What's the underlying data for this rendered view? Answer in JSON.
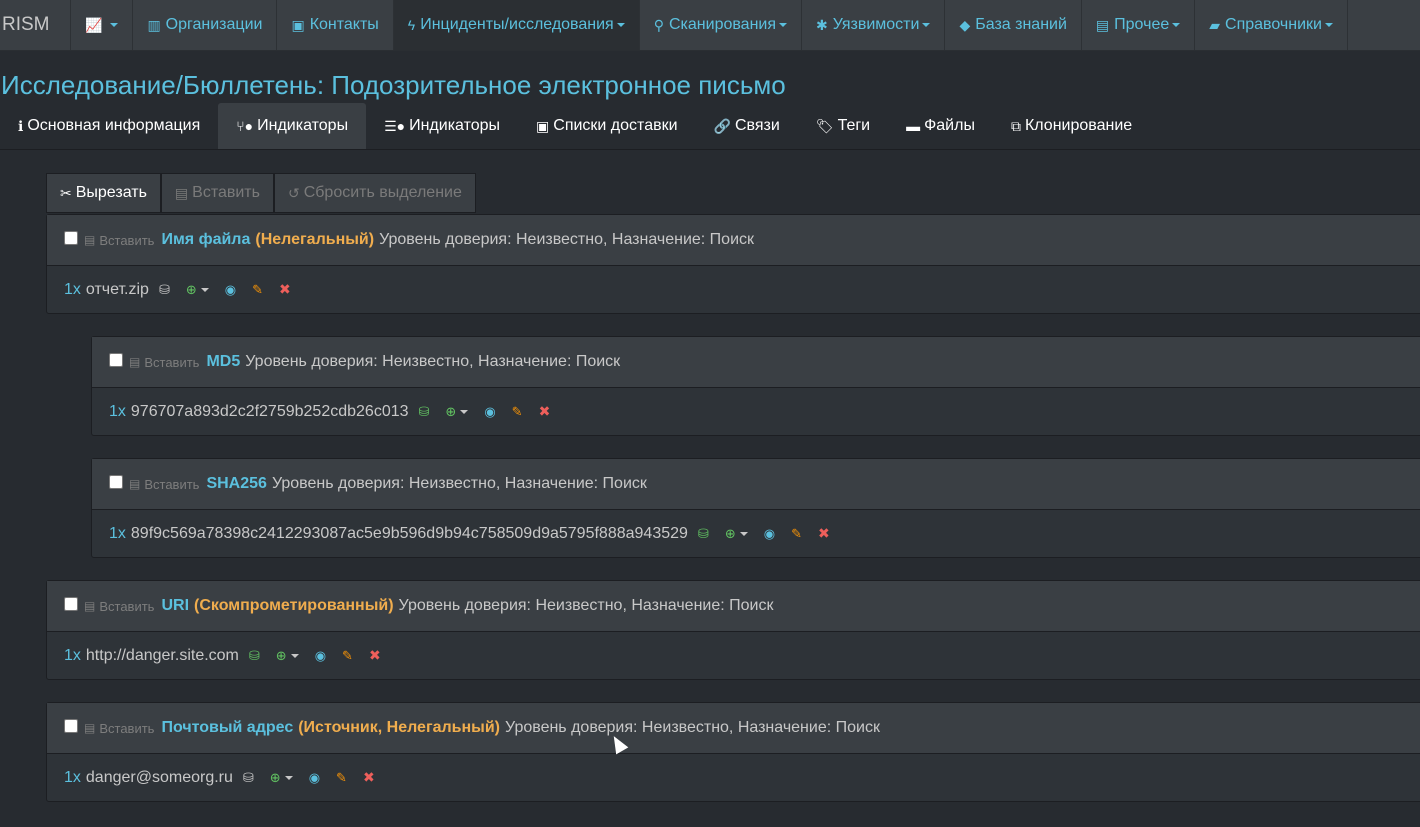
{
  "nav": {
    "brand": "RISM",
    "items": [
      {
        "label": "",
        "icon": "chart-icon",
        "caret": true
      },
      {
        "label": "Организации",
        "icon": "bar-chart-icon",
        "caret": false
      },
      {
        "label": "Контакты",
        "icon": "contact-card-icon",
        "caret": false
      },
      {
        "label": "Инциденты/исследования",
        "icon": "bolt-icon",
        "caret": true
      },
      {
        "label": "Сканирования",
        "icon": "search-icon",
        "caret": true
      },
      {
        "label": "Уязвимости",
        "icon": "bug-icon",
        "caret": true
      },
      {
        "label": "База знаний",
        "icon": "graduation-cap-icon",
        "caret": false
      },
      {
        "label": "Прочее",
        "icon": "archive-icon",
        "caret": true
      },
      {
        "label": "Справочники",
        "icon": "book-icon",
        "caret": true
      }
    ]
  },
  "page_title": "Исследование/Бюллетень: Подозрительное электронное письмо",
  "tabs": [
    {
      "label": "Основная информация",
      "icon": "info-icon"
    },
    {
      "label": "Индикаторы",
      "icon": "fork-bomb-icon"
    },
    {
      "label": "Индикаторы",
      "icon": "list-bomb-icon"
    },
    {
      "label": "Списки доставки",
      "icon": "address-book-icon"
    },
    {
      "label": "Связи",
      "icon": "link-icon"
    },
    {
      "label": "Теги",
      "icon": "tags-icon"
    },
    {
      "label": "Файлы",
      "icon": "folder-icon"
    },
    {
      "label": "Клонирование",
      "icon": "clone-icon"
    }
  ],
  "toolbar": {
    "cut": "Вырезать",
    "paste": "Вставить",
    "reset": "Сбросить выделение"
  },
  "paste_label": "Вставить",
  "indicators": [
    {
      "type": "Имя файла",
      "tags": "(Нелегальный)",
      "info": "Уровень доверия: Неизвестно, Назначение: Поиск",
      "count": "1x",
      "value": "отчет.zip",
      "db_found": false
    },
    {
      "type": "MD5",
      "tags": "",
      "info": "Уровень доверия: Неизвестно, Назначение: Поиск",
      "count": "1x",
      "value": "976707a893d2c2f2759b252cdb26c013",
      "db_found": true
    },
    {
      "type": "SHA256",
      "tags": "",
      "info": "Уровень доверия: Неизвестно, Назначение: Поиск",
      "count": "1x",
      "value": "89f9c569a78398c2412293087ac5e9b596d9b94c758509d9a5795f888a943529",
      "db_found": true
    },
    {
      "type": "URI",
      "tags": "(Скомпрометированный)",
      "info": "Уровень доверия: Неизвестно, Назначение: Поиск",
      "count": "1x",
      "value": "http://danger.site.com",
      "db_found": true
    },
    {
      "type": "Почтовый адрес",
      "tags": "(Источник, Нелегальный)",
      "info": "Уровень доверия: Неизвестно, Назначение: Поиск",
      "count": "1x",
      "value": "danger@someorg.ru",
      "db_found": false
    }
  ],
  "colors": {
    "accent": "#5bc0de",
    "tag": "#f0ad4e",
    "success": "#62c462",
    "warning": "#f89406",
    "danger": "#ee5f5b"
  }
}
